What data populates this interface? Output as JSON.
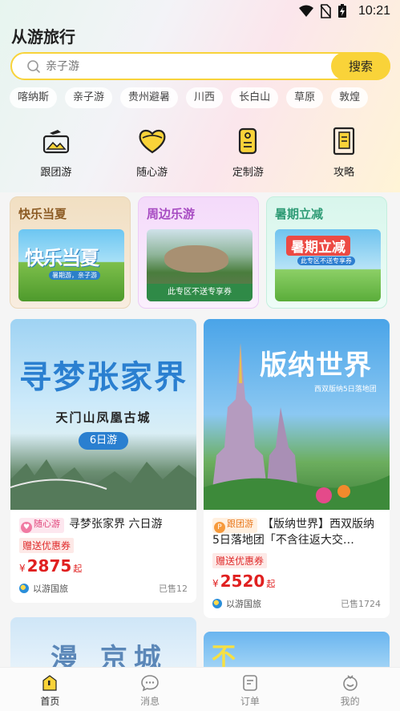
{
  "status_bar": {
    "time": "10:21"
  },
  "app": {
    "title": "从游旅行"
  },
  "search": {
    "placeholder": "亲子游",
    "button_label": "搜索"
  },
  "hot_tags": [
    "喀纳斯",
    "亲子游",
    "贵州避暑",
    "川西",
    "长白山",
    "草原",
    "敦煌"
  ],
  "quick_nav": [
    {
      "label": "跟团游",
      "icon": "group-tour-icon"
    },
    {
      "label": "随心游",
      "icon": "heart-icon"
    },
    {
      "label": "定制游",
      "icon": "custom-tour-icon"
    },
    {
      "label": "攻略",
      "icon": "guide-book-icon"
    }
  ],
  "promos": [
    {
      "title": "快乐当夏",
      "image_text": "快乐当夏",
      "image_sub": "暑期游，亲子游"
    },
    {
      "title": "周边乐游",
      "image_text": "此专区不送专享券"
    },
    {
      "title": "暑期立减",
      "image_text": "暑期立减",
      "image_sub": "此专区不送专享券"
    }
  ],
  "products": [
    {
      "image_title": "寻梦张家界",
      "image_subtitle": "天门山凤凰古城",
      "image_days": "6日游",
      "badge": "随心游",
      "title": "寻梦张家界 六日游",
      "coupon": "赠送优惠券",
      "currency": "¥",
      "price": "2875",
      "price_suffix": "起",
      "vendor": "以游国旅",
      "sold": "已售12"
    },
    {
      "image_title": "版纳世界",
      "image_subtitle": "西双版纳5日落地团",
      "badge": "跟团游",
      "title": "【版纳世界】西双版纳5日落地团「不含往返大交…",
      "coupon": "赠送优惠券",
      "currency": "¥",
      "price": "2520",
      "price_suffix": "起",
      "vendor": "以游国旅",
      "sold": "已售1724"
    }
  ],
  "more_cards": [
    {
      "image_text": "漫 京城"
    },
    {
      "image_text": "不 济"
    }
  ],
  "tabbar": [
    {
      "label": "首页",
      "active": true
    },
    {
      "label": "消息",
      "active": false
    },
    {
      "label": "订单",
      "active": false
    },
    {
      "label": "我的",
      "active": false
    }
  ],
  "colors": {
    "accent": "#f9d339",
    "price": "#e02020"
  }
}
